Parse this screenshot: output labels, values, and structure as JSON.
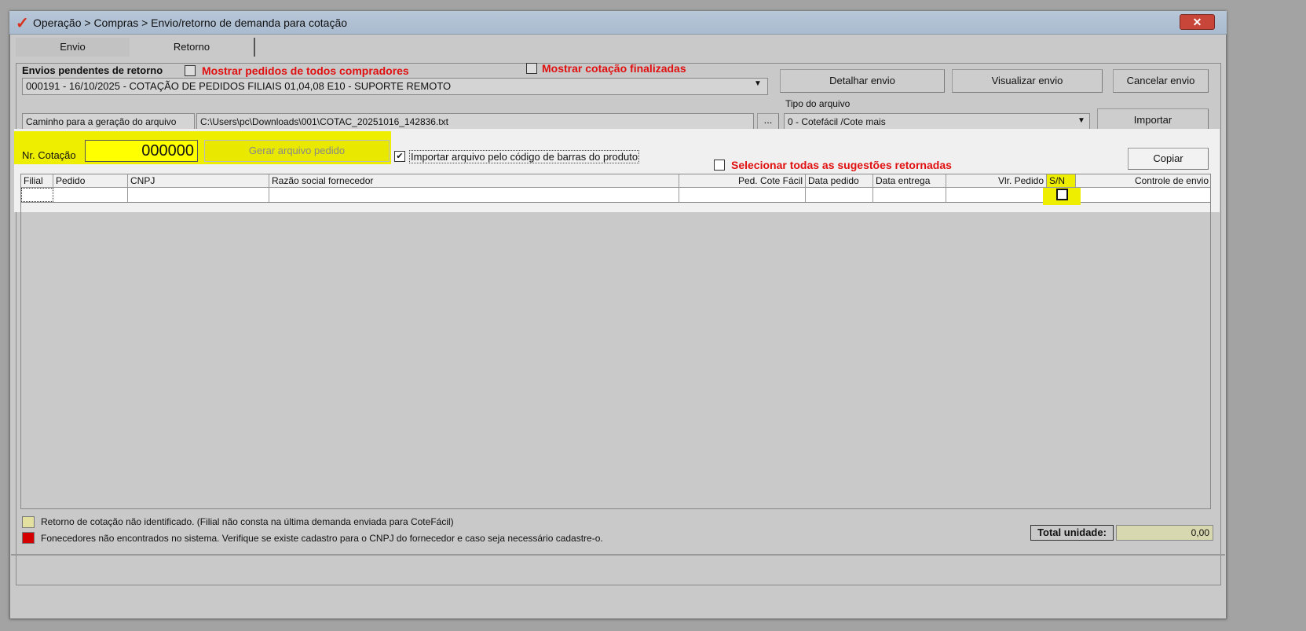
{
  "window": {
    "title": "Operação > Compras > Envio/retorno de demanda para cotação",
    "close": "✕"
  },
  "tabs": [
    "Envio",
    "Retorno"
  ],
  "envios": {
    "label": "Envios pendentes de retorno",
    "mostrar_todos": "Mostrar pedidos de todos compradores",
    "mostrar_finalizadas": "Mostrar cotação finalizadas",
    "selected": "000191 - 16/10/2025 - COTAÇÃO DE PEDIDOS FILIAIS 01,04,08 E10 - SUPORTE REMOTO"
  },
  "buttons": {
    "detalhar": "Detalhar envio",
    "visualizar": "Visualizar envio",
    "cancelar": "Cancelar envio",
    "importar": "Importar",
    "copiar": "Copiar",
    "gerar": "Gerar arquivo pedido",
    "browse": "..."
  },
  "caminho": {
    "label": "Caminho para a geração do arquivo",
    "value": "C:\\Users\\pc\\Downloads\\001\\COTAC_20251016_142836.txt"
  },
  "tipo": {
    "label": "Tipo do arquivo",
    "value": "0 - Cotefácil /Cote mais"
  },
  "cotacao": {
    "label": "Nr. Cotação",
    "value": "000000"
  },
  "importar_barras": {
    "label": "Importar arquivo pelo código de barras do produto",
    "checked": true
  },
  "selecionar_todas": "Selecionar todas as sugestões retornadas",
  "table": {
    "columns": [
      "Filial",
      "Pedido",
      "CNPJ",
      "Razão social fornecedor",
      "Ped. Cote Fácil",
      "Data pedido",
      "Data entrega",
      "Vlr. Pedido",
      "S/N",
      "Controle de envio"
    ]
  },
  "legend": [
    {
      "color": "#e4e0a0",
      "text": "Retorno de cotação não identificado. (Filial não consta na última demanda enviada para CoteFácil)"
    },
    {
      "color": "#d40000",
      "text": "Fonecedores não encontrados no sistema. Verifique se existe cadastro para o CNPJ do fornecedor e caso seja necessário cadastre-o."
    }
  ],
  "total": {
    "label": "Total unidade:",
    "value": "0,00"
  }
}
